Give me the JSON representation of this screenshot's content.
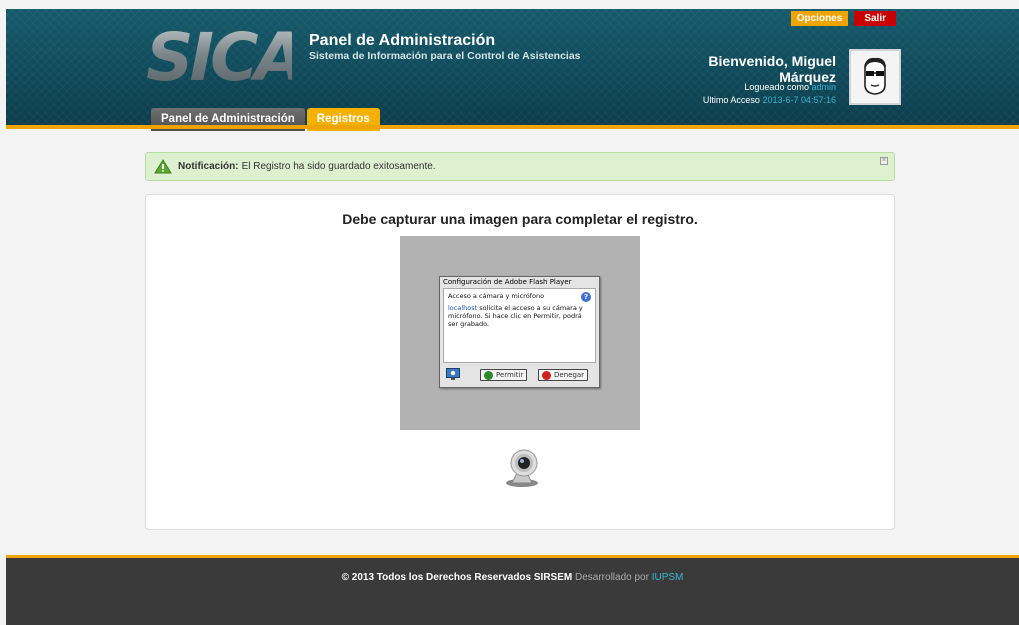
{
  "header": {
    "logo_text": "SICA",
    "title": "Panel de Administración",
    "subtitle": "Sistema de Información para el Control de Asistencias",
    "top_buttons": {
      "options_label": "Opciones",
      "logout_label": "Salir"
    },
    "welcome": "Bienvenido, Miguel Márquez",
    "logged_as_prefix": "Logueado como",
    "logged_as_user": "admin",
    "last_access_prefix": "Ultimo Acceso",
    "last_access_value": "2013-6-7 04:57:16",
    "tabs": [
      {
        "label": "Panel de Administración",
        "active": false
      },
      {
        "label": "Registros",
        "active": true
      }
    ]
  },
  "notification": {
    "label": "Notificación:",
    "message": "El Registro ha sido guardado exitosamente."
  },
  "main": {
    "title": "Debe capturar una imagen para completar el registro.",
    "flash_dialog": {
      "title": "Configuración de Adobe Flash Player",
      "heading": "Acceso a cámara y micrófono",
      "host": "localhost",
      "body": "solicita el acceso a su cámara y micrófono. Si hace clic en Permitir, podrá ser grabado.",
      "allow_label": "Permitir",
      "deny_label": "Denegar"
    }
  },
  "footer": {
    "copyright": "© 2013 Todos los Derechos Reservados SIRSEM",
    "developed_by": "Desarrollado por",
    "developer": "IUPSM"
  },
  "colors": {
    "header_bg": "#0f4a5a",
    "accent": "#f0a400",
    "danger": "#c80000",
    "link": "#3cb3d2",
    "footer_bg": "#3a3a3a"
  }
}
